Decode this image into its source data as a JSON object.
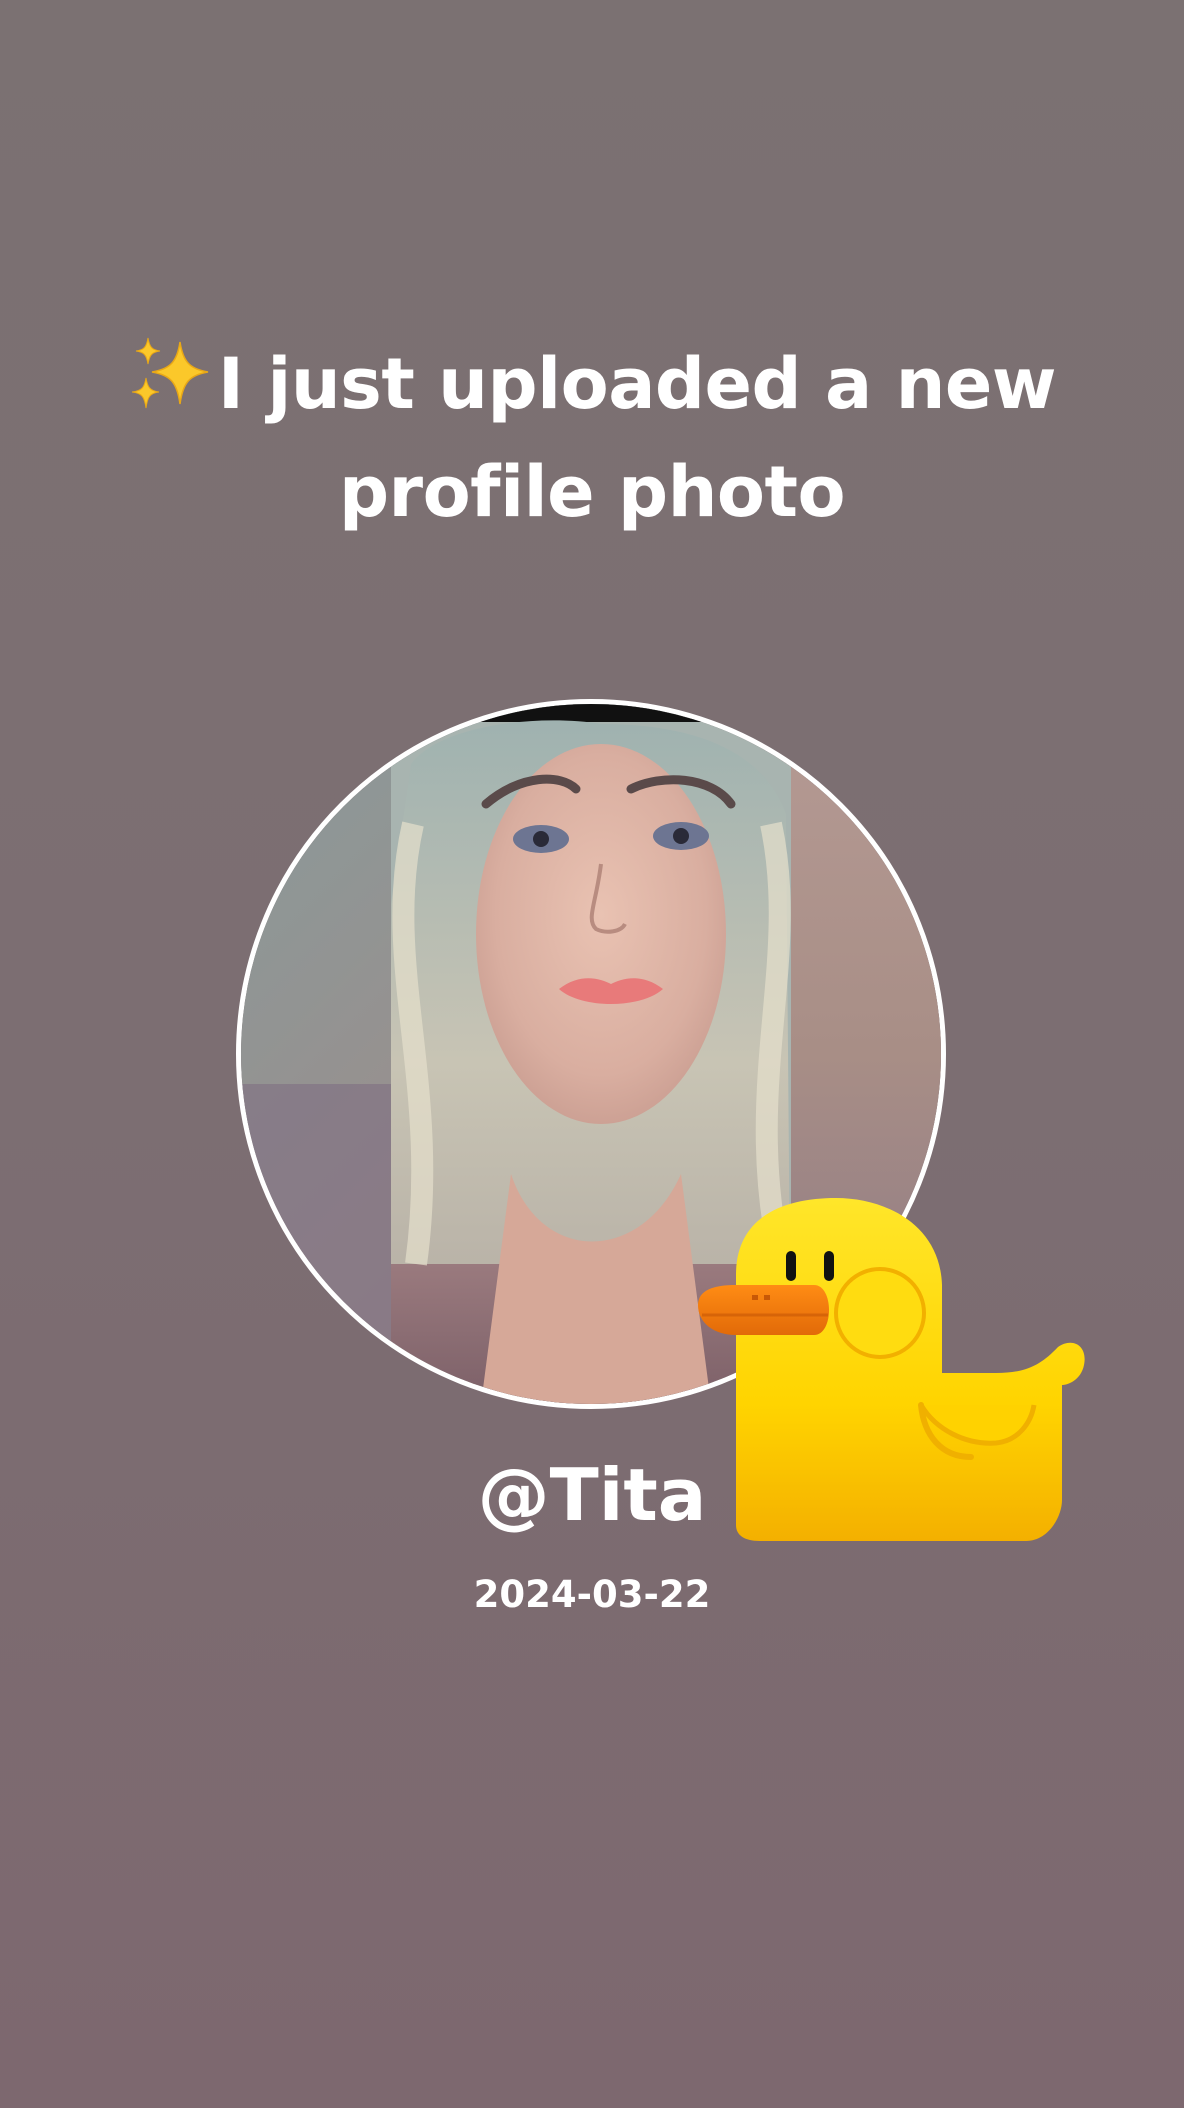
{
  "post": {
    "headline_line1": "I just uploaded a new",
    "headline_line2": "profile photo",
    "sparkle_emoji": "sparkles-icon",
    "username": "@Tita",
    "date": "2024-03-22"
  },
  "avatar": {
    "ring_color": "#ffffff"
  },
  "sticker": {
    "name": "yellow-duck-sticker",
    "body_color": "#ffe20a",
    "beak_color": "#f07c10"
  },
  "theme": {
    "background": "#7b6e72",
    "text": "#ffffff"
  }
}
